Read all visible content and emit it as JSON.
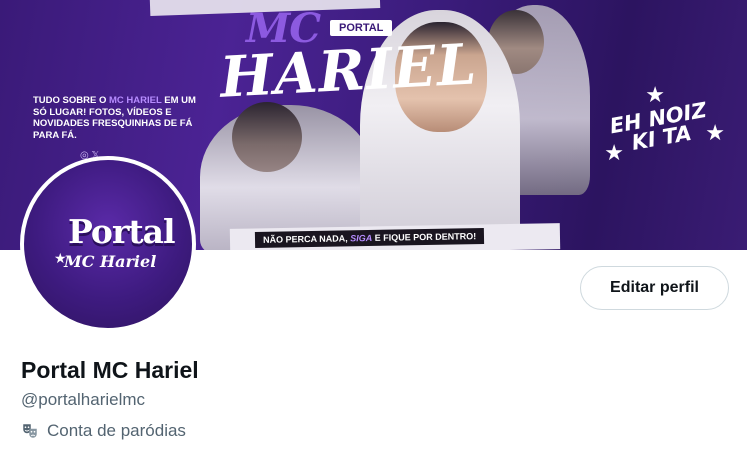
{
  "banner": {
    "title_mc": "MC",
    "portal_tag": "PORTAL",
    "title_hariel": "HARIEL",
    "about_prefix": "TUDO SOBRE O ",
    "about_highlight": "MC HARIEL",
    "about_suffix": " EM UM SÓ LUGAR! FOTOS, VÍDEOS E NOVIDADES FRESQUINHAS DE FÁ PARA FÁ.",
    "social_icons": "◎ 𝕏",
    "slogan_line1": "EH NOIZ",
    "slogan_line2": "KI TA",
    "strip_prefix": "NÃO PERCA NADA, ",
    "strip_highlight": "SIGA",
    "strip_suffix": " E FIQUE POR DENTRO!",
    "colors": {
      "primary": "#4b2394",
      "accent": "#b68cff"
    }
  },
  "avatar": {
    "logo_top": "Portal",
    "logo_bottom": "MC Hariel"
  },
  "actions": {
    "edit_profile_label": "Editar perfil"
  },
  "profile": {
    "display_name": "Portal MC Hariel",
    "handle": "@portalharielmc",
    "parody_icon": "theater-masks-icon",
    "parody_label": "Conta de paródias"
  }
}
